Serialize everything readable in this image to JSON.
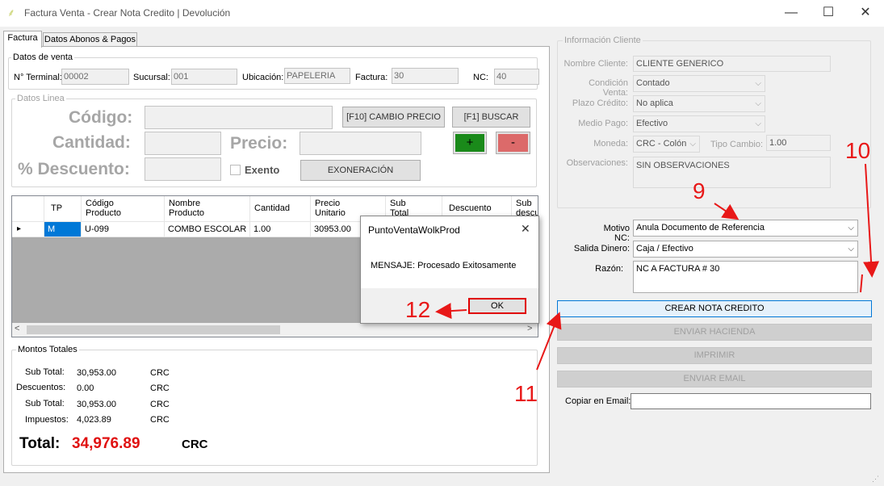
{
  "window": {
    "title": "Factura Venta - Crear Nota Credito | Devolución",
    "minimize": "—",
    "maximize": "☐",
    "close": "✕"
  },
  "tabs": [
    {
      "label": "Factura",
      "active": true
    },
    {
      "label": "Datos Abonos & Pagos",
      "active": false
    }
  ],
  "datos_venta": {
    "title": "Datos de venta",
    "terminal_label": "N° Terminal:",
    "terminal_value": "00002",
    "sucursal_label": "Sucursal:",
    "sucursal_value": "001",
    "ubicacion_label": "Ubicación:",
    "ubicacion_value": "PAPELERIA",
    "factura_label": "Factura:",
    "factura_value": "30",
    "nc_label": "NC:",
    "nc_value": "40"
  },
  "datos_linea": {
    "title": "Datos Linea",
    "codigo_label": "Código:",
    "cantidad_label": "Cantidad:",
    "precio_label": "Precio:",
    "descuento_label": "% Descuento:",
    "exento_label": "Exento",
    "cambio_precio_button": "[F10] CAMBIO PRECIO",
    "buscar_button": "[F1] BUSCAR",
    "add_button": "+",
    "remove_button": "-",
    "exoneracion_button": "EXONERACIÓN"
  },
  "grid": {
    "columns": [
      "TP",
      "Código\nProducto",
      "Nombre\nProducto",
      "Cantidad",
      "Precio\nUnitario",
      "Sub\nTotal",
      "Descuento",
      "Sub\ndescu"
    ],
    "rows": [
      {
        "tp": "M",
        "codigo": "U-099",
        "nombre": "COMBO ESCOLAR",
        "cantidad": "1.00",
        "precio": "30953.00"
      }
    ],
    "row_marker": "▸",
    "scroll_left": "<",
    "scroll_right": ">"
  },
  "montos": {
    "title": "Montos Totales",
    "subtotal_label": "Sub Total:",
    "subtotal_value": "30,953.00",
    "descuentos_label": "Descuentos:",
    "descuentos_value": "0.00",
    "subtotal2_label": "Sub Total:",
    "subtotal2_value": "30,953.00",
    "impuestos_label": "Impuestos:",
    "impuestos_value": "4,023.89",
    "currency": "CRC",
    "total_label": "Total:",
    "total_value": "34,976.89",
    "total_currency": "CRC"
  },
  "cliente": {
    "title": "Información Cliente",
    "nombre_label": "Nombre Cliente:",
    "nombre_value": "CLIENTE GENERICO",
    "condicion_label": "Condición Venta:",
    "condicion_value": "Contado",
    "plazo_label": "Plazo Crédito:",
    "plazo_value": "No aplica",
    "medio_label": "Medio Pago:",
    "medio_value": "Efectivo",
    "moneda_label": "Moneda:",
    "moneda_value": "CRC - Colón",
    "tipo_cambio_label": "Tipo Cambio:",
    "tipo_cambio_value": "1.00",
    "observaciones_label": "Observaciones:",
    "observaciones_value": "SIN OBSERVACIONES"
  },
  "nota_credito": {
    "motivo_label": "Motivo NC:",
    "motivo_value": "Anula Documento de Referencia",
    "salida_label": "Salida Dinero:",
    "salida_value": "Caja / Efectivo",
    "razon_label": "Razón:",
    "razon_value": "NC A FACTURA # 30",
    "crear_button": "CREAR NOTA CREDITO",
    "enviar_hacienda_button": "ENVIAR HACIENDA",
    "imprimir_button": "IMPRIMIR",
    "enviar_email_button": "ENVIAR EMAIL",
    "copiar_email_label": "Copiar en Email:",
    "copiar_email_value": ""
  },
  "dialog": {
    "title": "PuntoVentaWolkProd",
    "message": "MENSAJE: Procesado Exitosamente",
    "ok_button": "OK",
    "close": "✕"
  },
  "annotations": {
    "n9": "9",
    "n10": "10",
    "n11": "11",
    "n12": "12",
    "color": "#e81818"
  }
}
